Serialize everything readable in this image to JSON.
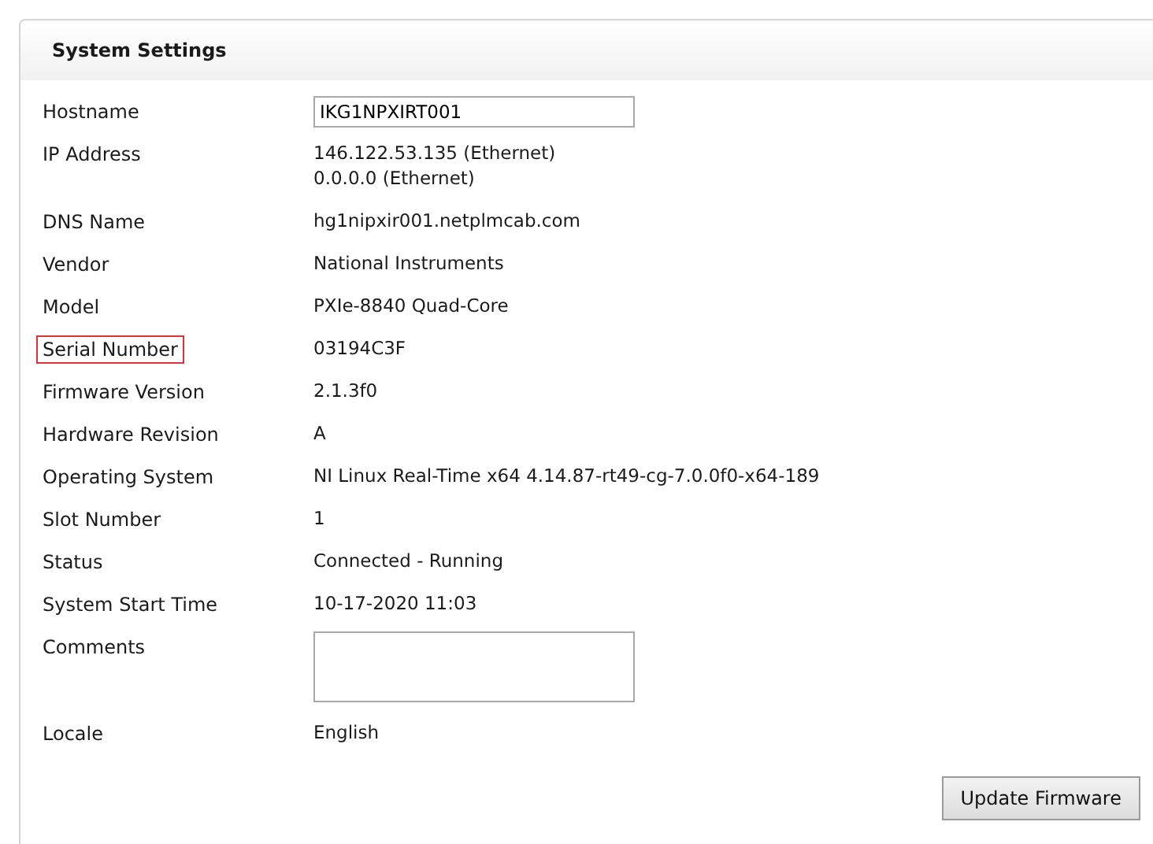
{
  "panel": {
    "title": "System Settings"
  },
  "fields": [
    {
      "label": "Hostname",
      "kind": "input",
      "value": "IKG1NPXIRT001",
      "highlighted": false
    },
    {
      "label": "IP Address",
      "kind": "lines",
      "lines": [
        "146.122.53.135 (Ethernet)",
        "0.0.0.0 (Ethernet)"
      ],
      "highlighted": false
    },
    {
      "label": "DNS Name",
      "kind": "text",
      "value": "hg1nipxir001.netplmcab.com",
      "highlighted": false
    },
    {
      "label": "Vendor",
      "kind": "text",
      "value": "National Instruments",
      "highlighted": false
    },
    {
      "label": "Model",
      "kind": "text",
      "value": "PXIe-8840 Quad-Core",
      "highlighted": false
    },
    {
      "label": "Serial Number",
      "kind": "text",
      "value": "03194C3F",
      "highlighted": true
    },
    {
      "label": "Firmware Version",
      "kind": "text",
      "value": "2.1.3f0",
      "highlighted": false
    },
    {
      "label": "Hardware Revision",
      "kind": "text",
      "value": "A",
      "highlighted": false
    },
    {
      "label": "Operating System",
      "kind": "text",
      "value": "NI Linux Real-Time x64 4.14.87-rt49-cg-7.0.0f0-x64-189",
      "highlighted": false
    },
    {
      "label": "Slot Number",
      "kind": "text",
      "value": "1",
      "highlighted": false
    },
    {
      "label": "Status",
      "kind": "text",
      "value": "Connected - Running",
      "highlighted": false
    },
    {
      "label": "System Start Time",
      "kind": "text",
      "value": "10-17-2020 11:03",
      "highlighted": false
    },
    {
      "label": "Comments",
      "kind": "textarea",
      "highlighted": false
    },
    {
      "label": "Locale",
      "kind": "text",
      "value": "English",
      "highlighted": false
    }
  ],
  "buttons": [
    "Update Firmware"
  ]
}
